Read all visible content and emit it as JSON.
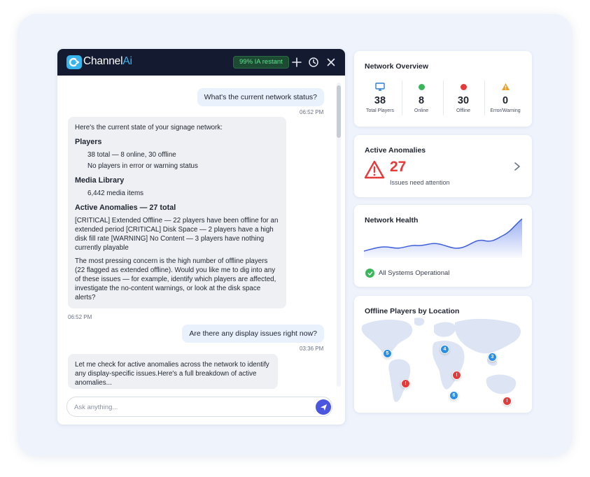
{
  "header": {
    "brand_main": "Channel",
    "brand_accent": "Ai",
    "status_pill": "99% IA restant"
  },
  "chat": {
    "messages": [
      {
        "role": "user",
        "text": "What's the current network status?",
        "time": "06:52 PM"
      },
      {
        "role": "assistant",
        "intro": "Here's the current state of your signage network:",
        "players_heading": "Players",
        "players_line1": "38 total — 8 online, 30 offline",
        "players_line2": "No players in error or warning status",
        "media_heading": "Media Library",
        "media_line": "6,442 media items",
        "anomalies_heading": "Active Anomalies — 27 total",
        "anomalies_text": "[CRITICAL] Extended Offline — 22 players have been offline for an extended period [CRITICAL] Disk Space — 2 players have a high disk fill rate [WARNING] No Content — 3 players have nothing currently playable",
        "closing": "The most pressing concern is the high number of offline players (22 flagged as extended offline). Would you like me to dig into any of these issues — for example, identify which players are affected, investigate the no-content warnings, or look at the disk space alerts?",
        "time": "06:52 PM"
      },
      {
        "role": "user",
        "text": "Are there any display issues right now?",
        "time": "03:36 PM"
      },
      {
        "role": "assistant",
        "text": "Let me check for active anomalies across the network to identify any display-specific issues.Here's a full breakdown of active anomalies..."
      }
    ],
    "input_placeholder": "Ask anything..."
  },
  "overview": {
    "title": "Network Overview",
    "stats": [
      {
        "icon": "monitor-icon",
        "value": "38",
        "label": "Total Players",
        "color": "#2b7fd8"
      },
      {
        "icon": "green-dot-icon",
        "value": "8",
        "label": "Online",
        "color": "#39b55a"
      },
      {
        "icon": "red-dot-icon",
        "value": "30",
        "label": "Offline",
        "color": "#e53a3a"
      },
      {
        "icon": "warning-icon",
        "value": "0",
        "label": "Error/Warning",
        "color": "#f0a020"
      }
    ]
  },
  "anomalies": {
    "title": "Active Anomalies",
    "count": "27",
    "subtitle": "Issues need attention"
  },
  "health": {
    "title": "Network Health",
    "status": "All Systems Operational"
  },
  "offline_map": {
    "title": "Offline Players by Location",
    "pins": [
      {
        "label": "5",
        "kind": "count"
      },
      {
        "label": "4",
        "kind": "count"
      },
      {
        "label": "3",
        "kind": "count"
      },
      {
        "label": "6",
        "kind": "count"
      },
      {
        "label": "!",
        "kind": "alert"
      },
      {
        "label": "!",
        "kind": "alert"
      },
      {
        "label": "!",
        "kind": "alert"
      }
    ]
  },
  "colors": {
    "header_bg": "#141a30",
    "accent": "#39b5ee",
    "send_button": "#4a55e0",
    "critical": "#e53a3a",
    "ok": "#39b55a"
  }
}
